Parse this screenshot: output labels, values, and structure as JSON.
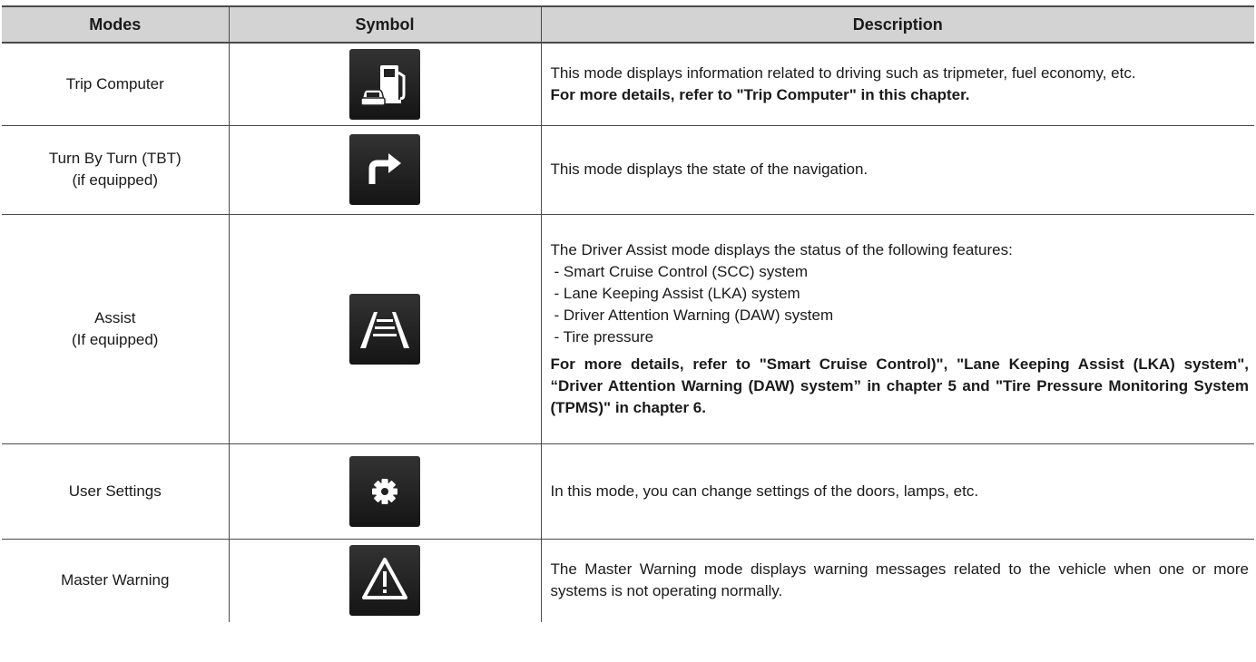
{
  "headers": {
    "modes": "Modes",
    "symbol": "Symbol",
    "description": "Description"
  },
  "rows": [
    {
      "mode_lines": [
        "Trip Computer"
      ],
      "icon": "fuel-pump-car-icon",
      "desc": "This mode displays information related to driving such as tripmeter, fuel economy, etc.",
      "desc_bold": "For more details, refer to \"Trip Computer\" in this chapter."
    },
    {
      "mode_lines": [
        "Turn By Turn (TBT)",
        "(if equipped)"
      ],
      "icon": "turn-right-arrow-icon",
      "desc": "This mode displays the state of the navigation."
    },
    {
      "mode_lines": [
        "Assist",
        "(If equipped)"
      ],
      "icon": "lane-road-icon",
      "desc": "The Driver Assist mode displays the status of the following features:",
      "bullets": [
        "- Smart Cruise Control (SCC) system",
        "- Lane Keeping Assist (LKA) system",
        "- Driver Attention Warning (DAW) system",
        "- Tire pressure"
      ],
      "desc_bold": "For more details, refer to \"Smart Cruise Control)\", \"Lane Keeping Assist (LKA) system\", “Driver Attention Warning (DAW) system” in chapter 5 and \"Tire Pressure Monitoring System (TPMS)\" in chapter 6."
    },
    {
      "mode_lines": [
        "User Settings"
      ],
      "icon": "gear-icon",
      "desc": "In this mode, you can change settings of the doors, lamps, etc."
    },
    {
      "mode_lines": [
        "Master Warning"
      ],
      "icon": "warning-triangle-icon",
      "desc": "The Master Warning mode displays warning messages related to the vehicle when one or more systems is not operating normally."
    }
  ]
}
